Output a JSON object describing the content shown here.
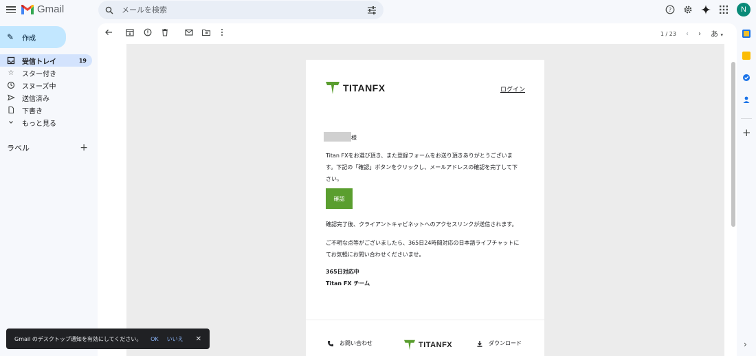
{
  "app": {
    "name": "Gmail"
  },
  "search": {
    "placeholder": "メールを検索"
  },
  "user": {
    "initial": "N"
  },
  "sidebar": {
    "compose_label": "作成",
    "items": [
      {
        "label": "受信トレイ",
        "count": "19",
        "icon": "inbox-icon"
      },
      {
        "label": "スター付き",
        "count": "",
        "icon": "star-icon"
      },
      {
        "label": "スヌーズ中",
        "count": "",
        "icon": "clock-icon"
      },
      {
        "label": "送信済み",
        "count": "",
        "icon": "send-icon"
      },
      {
        "label": "下書き",
        "count": "",
        "icon": "draft-icon"
      },
      {
        "label": "もっと見る",
        "count": "",
        "icon": "chevron-down-icon"
      }
    ],
    "labels_heading": "ラベル"
  },
  "toolbar": {
    "pager": "1 / 23",
    "lang_label": "あ"
  },
  "email": {
    "brand": "TITANFX",
    "login_link": "ログイン",
    "salutation_suffix": "様",
    "para1_line1": "Titan FXをお選び頂き、また登録フォームをお送り頂きありがとうございま",
    "para1_line2": "す。下記の「確認」ボタンをクリックし、メールアドレスの確認を完了して下",
    "para1_line3": "さい。",
    "confirm_button": "確認",
    "para2": "確認完了後、クライアントキャビネットへのアクセスリンクが送信されます。",
    "para3_line1": "ご不明な点等がございましたら、365日24時間対応の日本語ライブチャットに",
    "para3_line2": "てお気軽にお問い合わせくださいませ。",
    "sig1": "365日対応中",
    "sig2": "Titan FX チーム",
    "footer_contact": "お問い合わせ",
    "footer_download": "ダウンロード"
  },
  "snackbar": {
    "message": "Gmail のデスクトップ通知を有効にしてください。",
    "ok": "OK",
    "no": "いいえ"
  },
  "colors": {
    "brand_green": "#5a9e2f",
    "compose_bg": "#c2e7ff",
    "inbox_active_bg": "#d3e3fd",
    "avatar_bg": "#0a8a78"
  }
}
